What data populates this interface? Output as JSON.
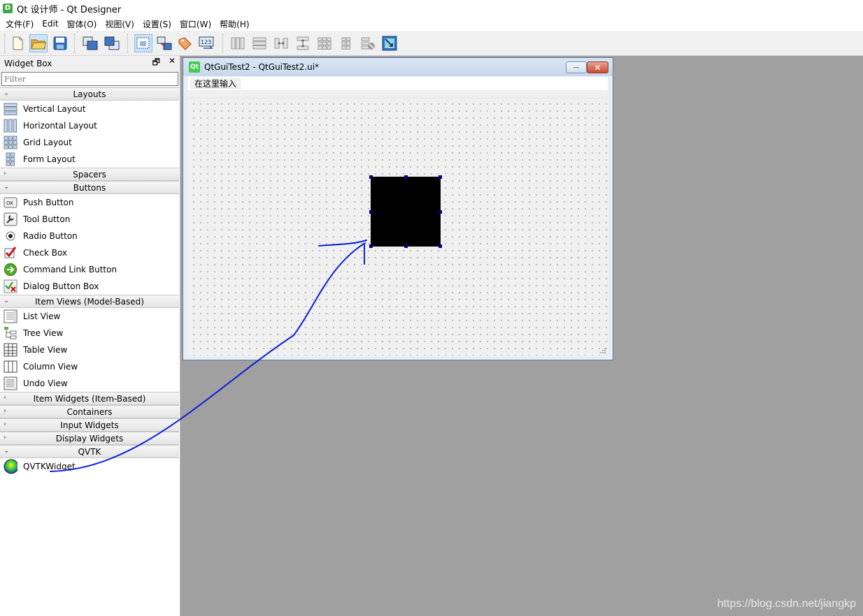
{
  "app": {
    "icon_letter": "D",
    "title": "Qt 设计师 - Qt Designer"
  },
  "menubar": [
    "文件(F)",
    "Edit",
    "窗体(O)",
    "视图(V)",
    "设置(S)",
    "窗口(W)",
    "帮助(H)"
  ],
  "toolbar": {
    "buttons": [
      "new-file-icon",
      "open-folder-icon",
      "save-icon",
      "send-to-back-icon",
      "bring-to-front-icon",
      "edit-widgets-icon",
      "edit-signals-slots-icon",
      "edit-buddies-icon",
      "edit-tab-order-icon",
      "layout-horizontal-icon",
      "layout-vertical-icon",
      "layout-horizontal-splitter-icon",
      "layout-vertical-splitter-icon",
      "layout-grid-icon",
      "layout-form-icon",
      "break-layout-icon",
      "adjust-size-icon"
    ],
    "active": "edit-widgets-icon"
  },
  "widget_box": {
    "title": "Widget Box",
    "float_glyph": "🗗",
    "close_glyph": "✕",
    "filter_placeholder": "Filter",
    "categories": [
      {
        "label": "Layouts",
        "expanded": true,
        "items": [
          {
            "label": "Vertical Layout",
            "icon": "vertical-layout-icon"
          },
          {
            "label": "Horizontal Layout",
            "icon": "horizontal-layout-icon"
          },
          {
            "label": "Grid Layout",
            "icon": "grid-layout-icon"
          },
          {
            "label": "Form Layout",
            "icon": "form-layout-icon"
          }
        ]
      },
      {
        "label": "Spacers",
        "expanded": false,
        "items": []
      },
      {
        "label": "Buttons",
        "expanded": true,
        "items": [
          {
            "label": "Push Button",
            "icon": "push-button-icon",
            "glyph": "OK"
          },
          {
            "label": "Tool Button",
            "icon": "tool-button-icon"
          },
          {
            "label": "Radio Button",
            "icon": "radio-button-icon"
          },
          {
            "label": "Check Box",
            "icon": "check-box-icon"
          },
          {
            "label": "Command Link Button",
            "icon": "command-link-icon"
          },
          {
            "label": "Dialog Button Box",
            "icon": "dialog-button-box-icon"
          }
        ]
      },
      {
        "label": "Item Views (Model-Based)",
        "expanded": true,
        "items": [
          {
            "label": "List View",
            "icon": "list-view-icon"
          },
          {
            "label": "Tree View",
            "icon": "tree-view-icon"
          },
          {
            "label": "Table View",
            "icon": "table-view-icon"
          },
          {
            "label": "Column View",
            "icon": "column-view-icon"
          },
          {
            "label": "Undo View",
            "icon": "undo-view-icon"
          }
        ]
      },
      {
        "label": "Item Widgets (Item-Based)",
        "expanded": false,
        "items": []
      },
      {
        "label": "Containers",
        "expanded": false,
        "items": []
      },
      {
        "label": "Input Widgets",
        "expanded": false,
        "items": []
      },
      {
        "label": "Display Widgets",
        "expanded": false,
        "items": []
      },
      {
        "label": "QVTK",
        "expanded": true,
        "items": [
          {
            "label": "QVTKWidget",
            "icon": "qvtk-widget-icon"
          }
        ]
      }
    ]
  },
  "form_window": {
    "icon_letter": "Qt",
    "title": "QtGuiTest2 - QtGuiTest2.ui*",
    "minimize_glyph": "—",
    "close_glyph": "✕",
    "menu_placeholder": "在这里输入",
    "placed_widget": "QVTKWidget",
    "placed_widget_color": "#000000"
  },
  "annotation_color": "#0a1fd6",
  "watermark": "https://blog.csdn.net/jiangkp"
}
